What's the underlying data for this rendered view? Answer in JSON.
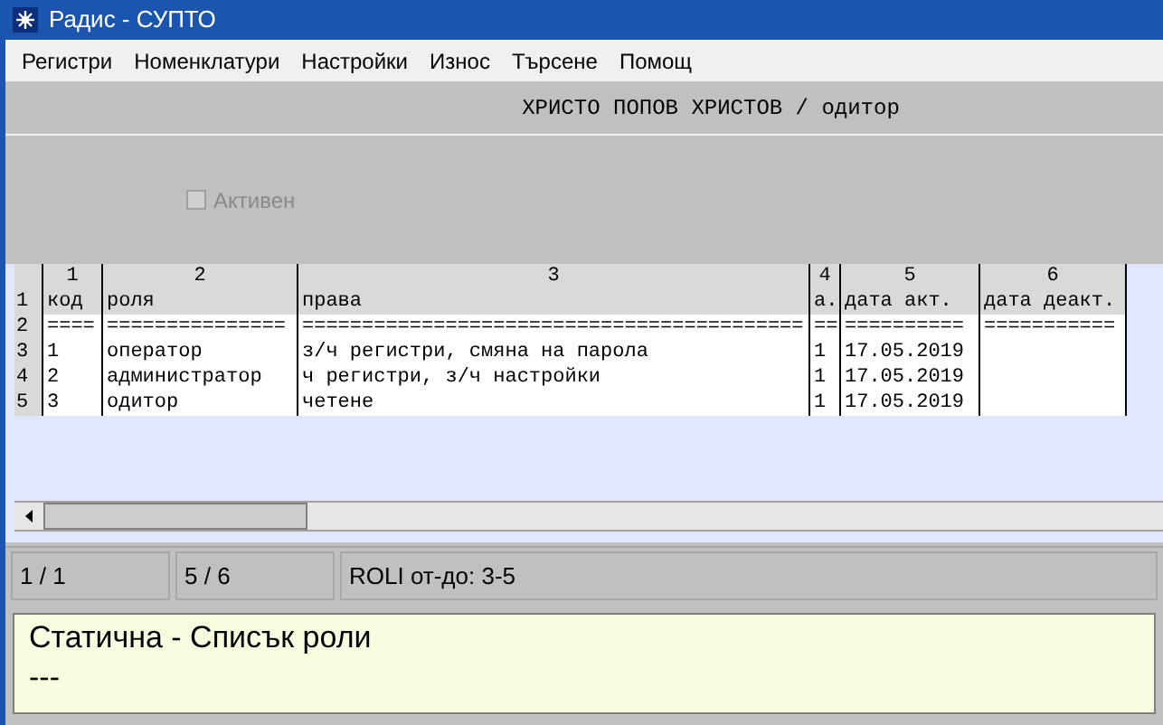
{
  "window": {
    "title": "Радис - СУПТО"
  },
  "menu": [
    {
      "label": "Регистри"
    },
    {
      "label": "Номенклатури"
    },
    {
      "label": "Настройки"
    },
    {
      "label": "Износ"
    },
    {
      "label": "Търсене"
    },
    {
      "label": "Помощ"
    }
  ],
  "header": {
    "title": "ХРИСТО ПОПОВ ХРИСТОВ / одитор"
  },
  "active_checkbox": {
    "label": "Активен",
    "checked": false,
    "disabled": true
  },
  "grid": {
    "column_numbers": [
      "1",
      "2",
      "3",
      "4",
      "5",
      "6"
    ],
    "rows": [
      {
        "number": "1",
        "kind": "header",
        "cells": [
          "код",
          "роля",
          "права",
          "а.",
          "дата акт.",
          "дата деакт."
        ]
      },
      {
        "number": "2",
        "kind": "data",
        "cells": [
          "====",
          "===============",
          "==========================================",
          "==",
          "==========",
          "==========="
        ]
      },
      {
        "number": "3",
        "kind": "data",
        "cells": [
          "1",
          "оператор",
          "з/ч регистри, смяна на парола",
          "1",
          "17.05.2019",
          ""
        ]
      },
      {
        "number": "4",
        "kind": "data",
        "cells": [
          "2",
          "администратор",
          "ч регистри, з/ч настройки",
          "1",
          "17.05.2019",
          ""
        ]
      },
      {
        "number": "5",
        "kind": "data",
        "cells": [
          "3",
          "одитор",
          "четене",
          "1",
          "17.05.2019",
          ""
        ]
      }
    ]
  },
  "status_bar": [
    "1 / 1",
    "5 / 6",
    "ROLI от-до: 3-5"
  ],
  "message": {
    "title": "Статична - Списък роли",
    "detail": "---"
  }
}
